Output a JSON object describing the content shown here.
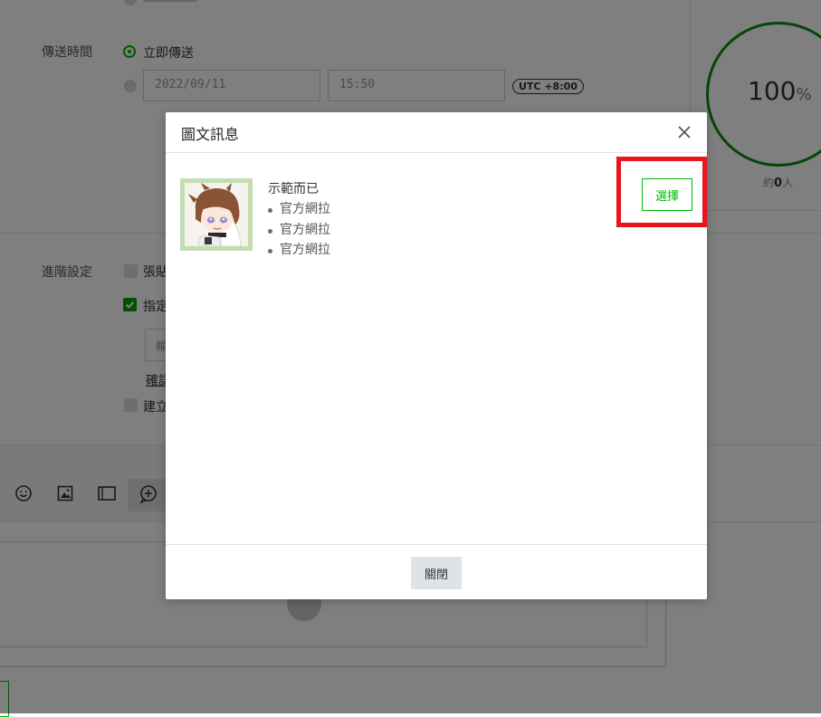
{
  "background": {
    "send_time_label": "傳送時間",
    "send_now_label": "立即傳送",
    "date_value": "2022/09/11",
    "time_value": "15:50",
    "timezone_badge": "UTC +8:00",
    "gauge_value": "100",
    "gauge_unit": "%",
    "audience_prefix": "約",
    "audience_count": "0",
    "audience_suffix": "人",
    "advanced_label": "進階設定",
    "option_sticker": "張貼",
    "option_specify": "指定",
    "option_confirm": "確認",
    "option_create": "建立",
    "input_fragment": "輸",
    "accent_color": "#00b900",
    "gauge_color": "#0a8a0a"
  },
  "modal": {
    "title": "圖文訊息",
    "item": {
      "title": "示範而已",
      "bullets": [
        "官方網拉",
        "官方網拉",
        "官方網拉"
      ]
    },
    "select_label": "選擇",
    "close_label": "關閉",
    "highlight_color": "#e8151f"
  }
}
